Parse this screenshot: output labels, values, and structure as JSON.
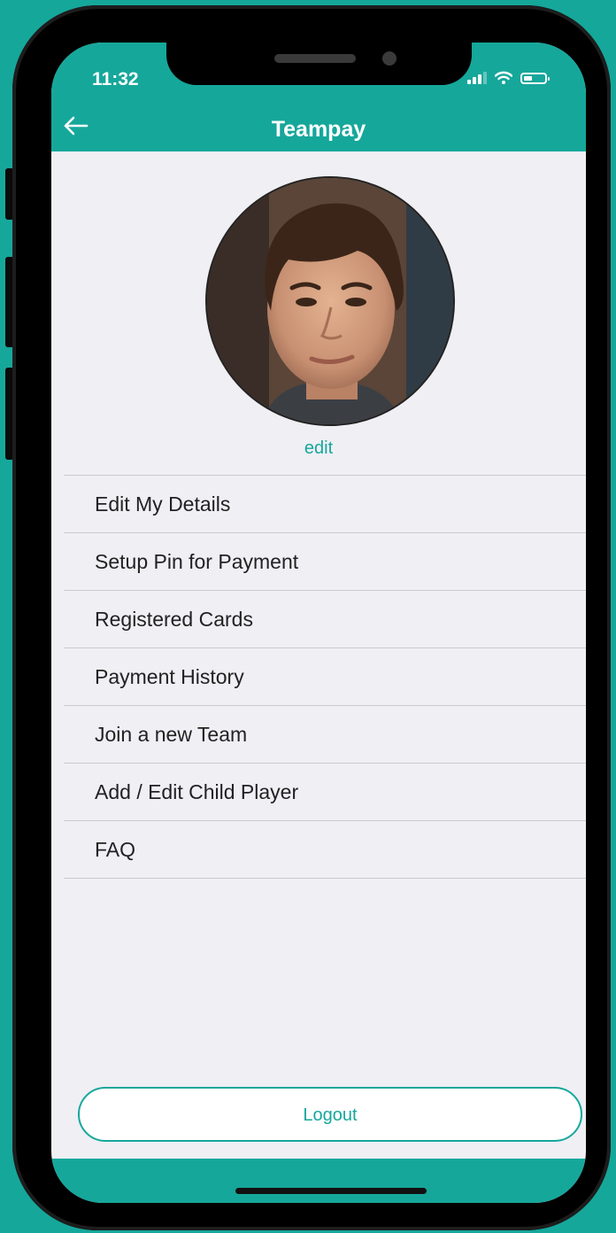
{
  "status_bar": {
    "time": "11:32",
    "icons": [
      "signal-icon",
      "wifi-icon",
      "battery-icon"
    ]
  },
  "header": {
    "title": "Teampay",
    "back_icon": "arrow-left-icon"
  },
  "profile": {
    "avatar": "profile-photo",
    "edit_label": "edit"
  },
  "menu": {
    "items": [
      {
        "label": "Edit My Details"
      },
      {
        "label": "Setup Pin for Payment"
      },
      {
        "label": "Registered Cards"
      },
      {
        "label": "Payment History"
      },
      {
        "label": "Join a new Team"
      },
      {
        "label": "Add / Edit Child Player"
      },
      {
        "label": "FAQ"
      }
    ]
  },
  "logout": {
    "label": "Logout"
  },
  "colors": {
    "accent": "#16a79b",
    "background": "#efeff4",
    "separator": "#c9c9ce",
    "text": "#222222"
  }
}
